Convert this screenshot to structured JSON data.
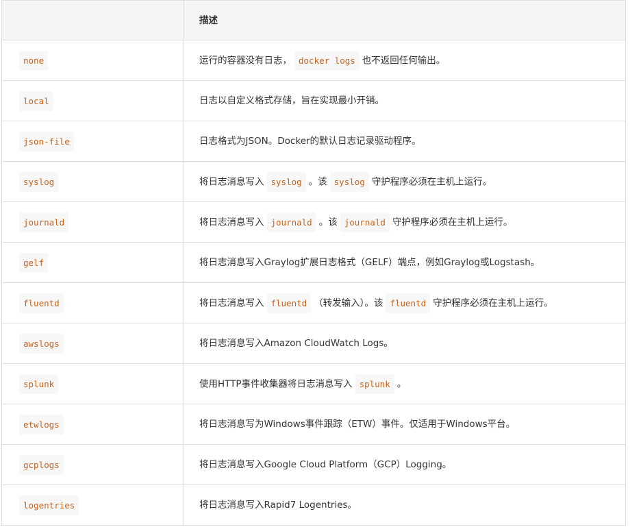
{
  "header": {
    "col1": "",
    "col2": "描述"
  },
  "rows": [
    {
      "driver": "none",
      "parts": [
        {
          "t": "text",
          "v": "运行的容器没有日志，"
        },
        {
          "t": "code",
          "v": "docker logs"
        },
        {
          "t": "text",
          "v": "也不返回任何输出。"
        }
      ]
    },
    {
      "driver": "local",
      "parts": [
        {
          "t": "text",
          "v": "日志以自定义格式存储，旨在实现最小开销。"
        }
      ]
    },
    {
      "driver": "json-file",
      "parts": [
        {
          "t": "text",
          "v": "日志格式为JSON。Docker的默认日志记录驱动程序。"
        }
      ]
    },
    {
      "driver": "syslog",
      "parts": [
        {
          "t": "text",
          "v": "将日志消息写入"
        },
        {
          "t": "code",
          "v": "syslog"
        },
        {
          "t": "text",
          "v": "。该"
        },
        {
          "t": "code",
          "v": "syslog"
        },
        {
          "t": "text",
          "v": "守护程序必须在主机上运行。"
        }
      ]
    },
    {
      "driver": "journald",
      "parts": [
        {
          "t": "text",
          "v": "将日志消息写入"
        },
        {
          "t": "code",
          "v": "journald"
        },
        {
          "t": "text",
          "v": "。该"
        },
        {
          "t": "code",
          "v": "journald"
        },
        {
          "t": "text",
          "v": "守护程序必须在主机上运行。"
        }
      ]
    },
    {
      "driver": "gelf",
      "parts": [
        {
          "t": "text",
          "v": "将日志消息写入Graylog扩展日志格式（GELF）端点，例如Graylog或Logstash。"
        }
      ]
    },
    {
      "driver": "fluentd",
      "parts": [
        {
          "t": "text",
          "v": "将日志消息写入"
        },
        {
          "t": "code",
          "v": "fluentd"
        },
        {
          "t": "text",
          "v": "（转发输入）。该"
        },
        {
          "t": "code",
          "v": "fluentd"
        },
        {
          "t": "text",
          "v": "守护程序必须在主机上运行。"
        }
      ]
    },
    {
      "driver": "awslogs",
      "parts": [
        {
          "t": "text",
          "v": "将日志消息写入Amazon CloudWatch Logs。"
        }
      ]
    },
    {
      "driver": "splunk",
      "parts": [
        {
          "t": "text",
          "v": "使用HTTP事件收集器将日志消息写入"
        },
        {
          "t": "code",
          "v": "splunk"
        },
        {
          "t": "text",
          "v": "。"
        }
      ]
    },
    {
      "driver": "etwlogs",
      "parts": [
        {
          "t": "text",
          "v": "将日志消息写为Windows事件跟踪（ETW）事件。仅适用于Windows平台。"
        }
      ]
    },
    {
      "driver": "gcplogs",
      "parts": [
        {
          "t": "text",
          "v": "将日志消息写入Google Cloud Platform（GCP）Logging。"
        }
      ]
    },
    {
      "driver": "logentries",
      "parts": [
        {
          "t": "text",
          "v": "将日志消息写入Rapid7 Logentries。"
        }
      ]
    }
  ]
}
